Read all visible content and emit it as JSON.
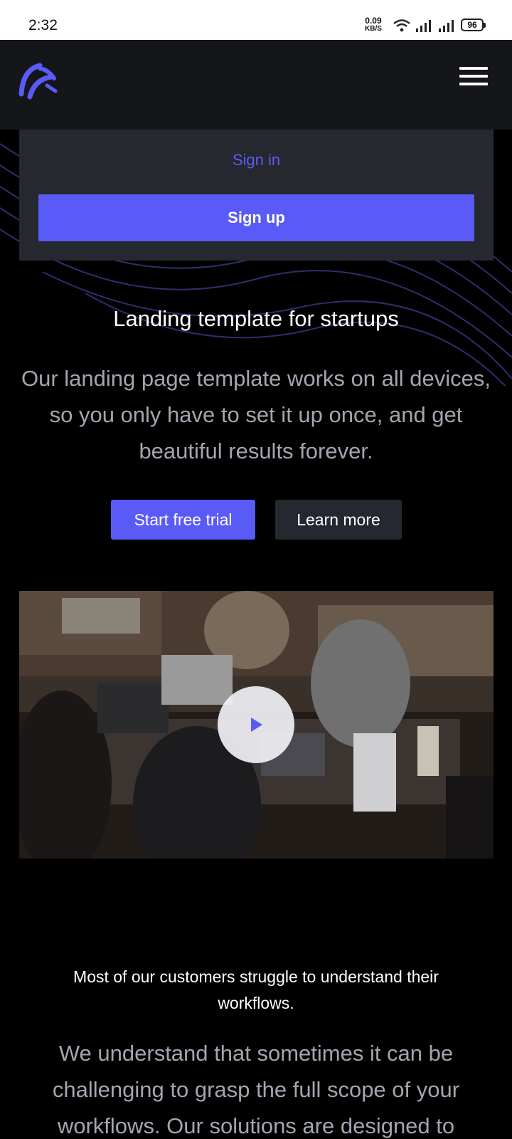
{
  "status_bar": {
    "time": "2:32",
    "net_speed_value": "0.09",
    "net_speed_unit": "KB/S",
    "battery": "96"
  },
  "header": {
    "logo_icon": "logo-icon",
    "menu_icon": "hamburger-menu-icon"
  },
  "nav_dropdown": {
    "sign_in": "Sign in",
    "sign_up": "Sign up"
  },
  "hero": {
    "title": "Landing template for startups",
    "subtitle": "Our landing page template works on all devices, so you only have to set it up once, and get beautiful results forever.",
    "primary_button": "Start free trial",
    "secondary_button": "Learn more"
  },
  "video": {
    "play_icon": "play-icon"
  },
  "features": {
    "title": "Most of our customers struggle to understand their workflows.",
    "subtitle": "We understand that sometimes it can be challenging to grasp the full scope of your workflows. Our solutions are designed to"
  },
  "colors": {
    "accent": "#5a5af6",
    "background": "#000000",
    "header_bg": "#151619",
    "panel_bg": "#25282e",
    "muted_text": "#a2a6b0"
  }
}
